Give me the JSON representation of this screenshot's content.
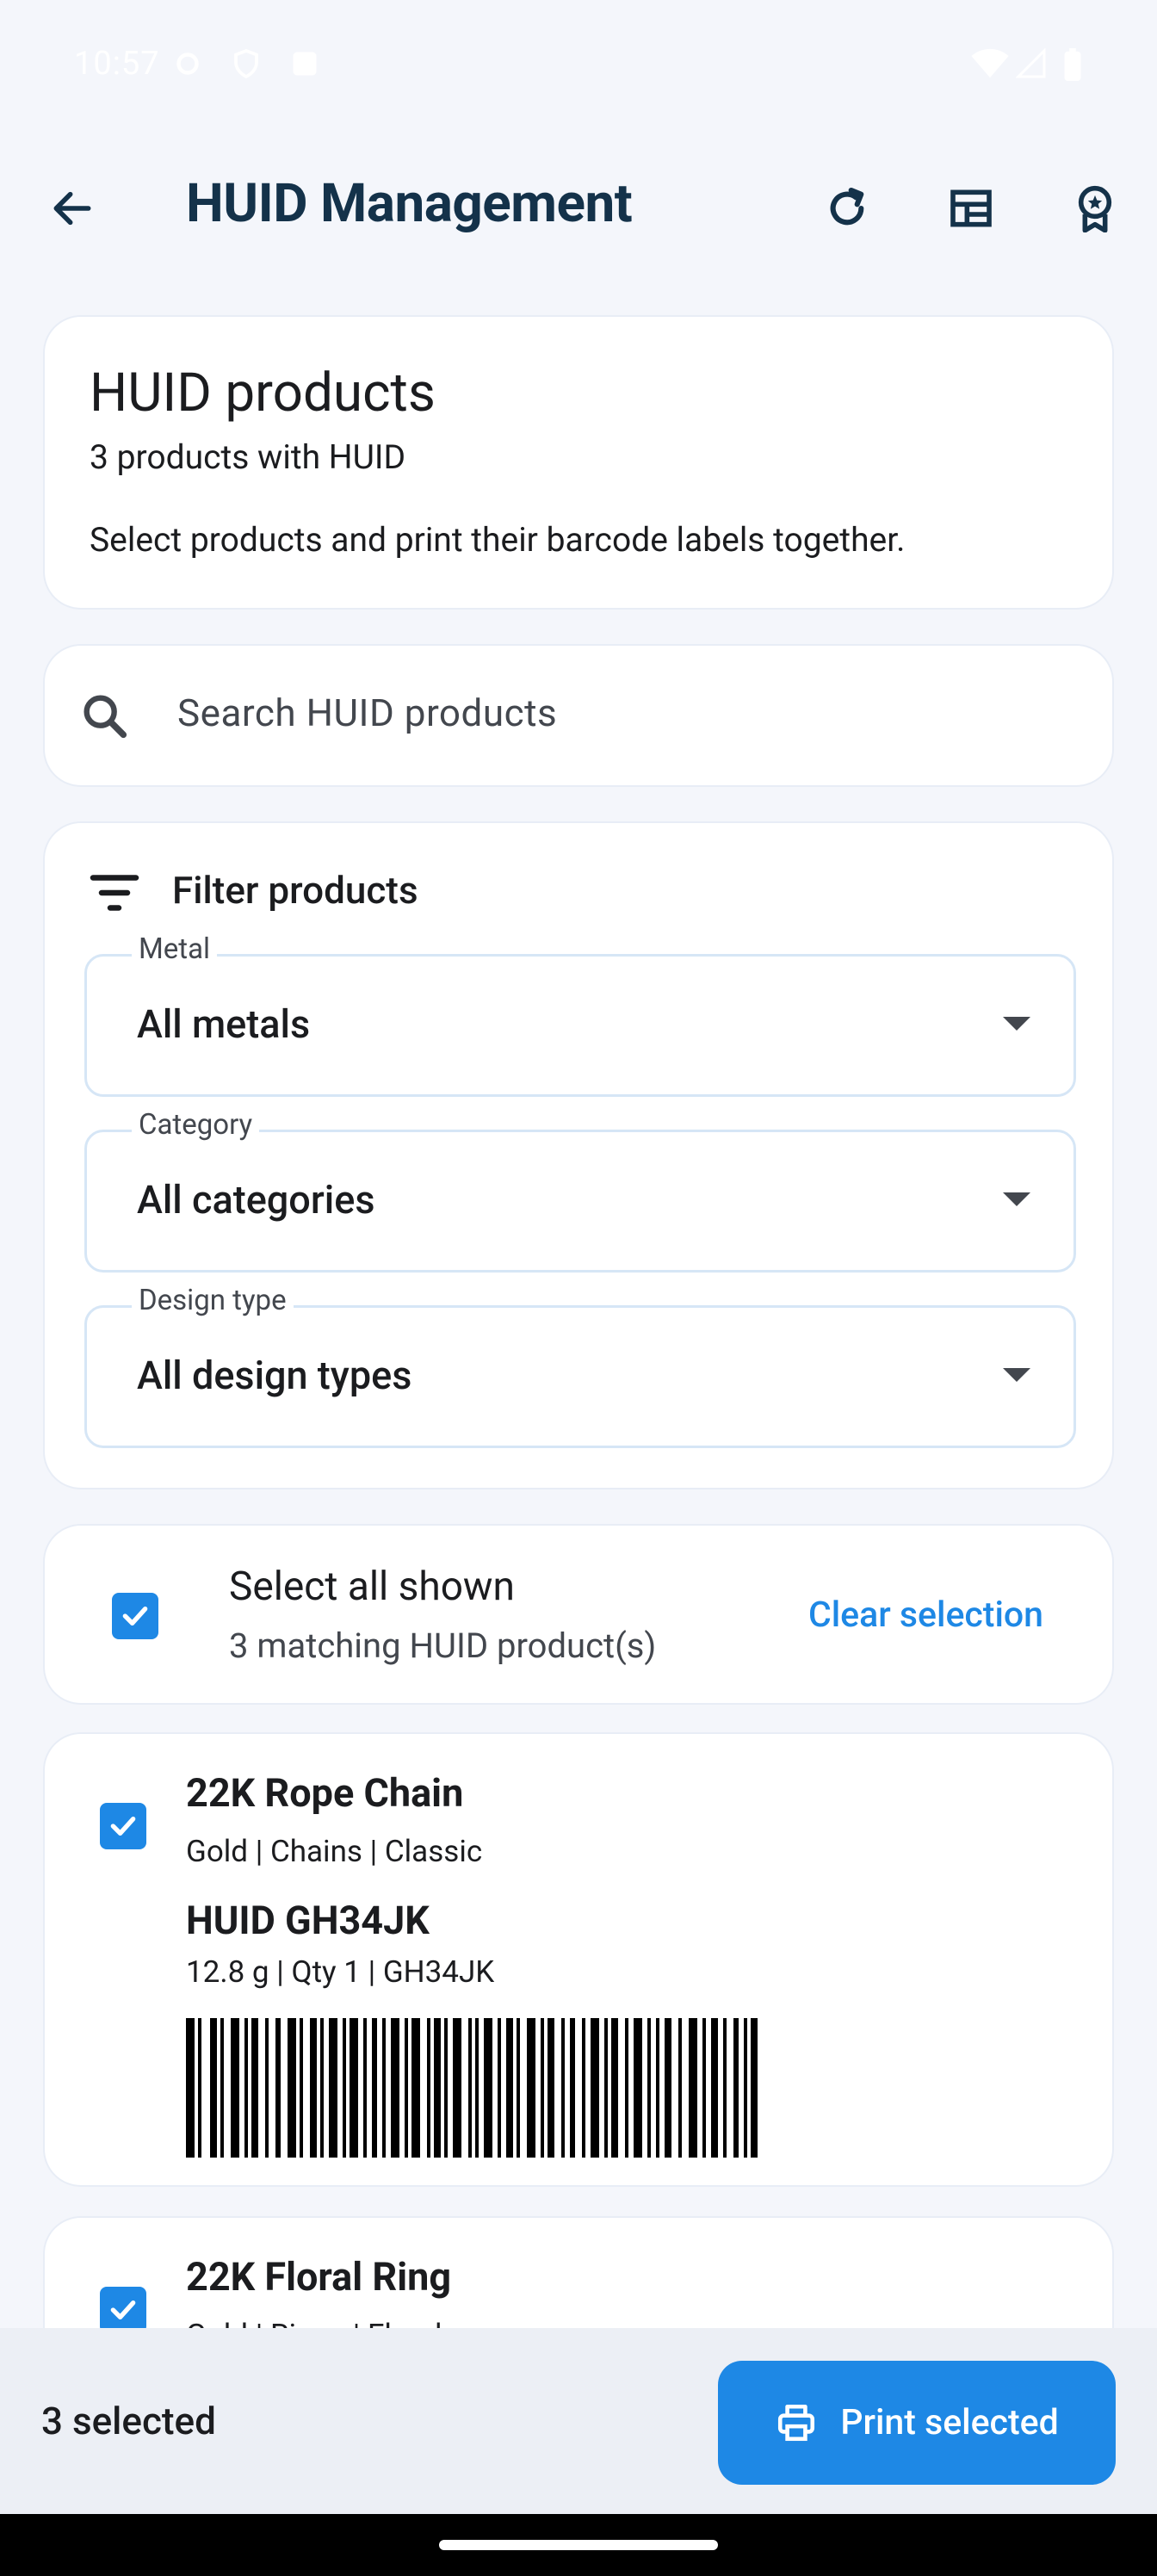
{
  "status_bar": {
    "time": "10:57"
  },
  "app_bar": {
    "title": "HUID Management",
    "icons": [
      "back-arrow-icon",
      "refresh-icon",
      "dashboard-icon",
      "award-icon"
    ]
  },
  "hero": {
    "title": "HUID products",
    "subtitle": "3 products with HUID",
    "description": "Select products and print their barcode labels together."
  },
  "search": {
    "placeholder": "Search HUID products"
  },
  "filters": {
    "title": "Filter products",
    "fields": [
      {
        "label": "Metal",
        "value": "All metals"
      },
      {
        "label": "Category",
        "value": "All categories"
      },
      {
        "label": "Design type",
        "value": "All design types"
      }
    ]
  },
  "selection": {
    "title": "Select all shown",
    "subtitle": "3 matching HUID product(s)",
    "clear_label": "Clear selection",
    "checked": true
  },
  "products": [
    {
      "name": "22K Rope Chain",
      "meta": "Gold | Chains | Classic",
      "huid": "HUID GH34JK",
      "detail": "12.8 g | Qty 1 | GH34JK",
      "checked": true
    },
    {
      "name": "22K Floral Ring",
      "meta": "Gold | Rings | Floral",
      "checked": true
    }
  ],
  "bottom_bar": {
    "selected_count": "3 selected",
    "print_label": "Print selected"
  },
  "colors": {
    "accent": "#1e88e5",
    "title": "#14324a",
    "background": "#f4f6fb",
    "card": "#ffffff"
  }
}
